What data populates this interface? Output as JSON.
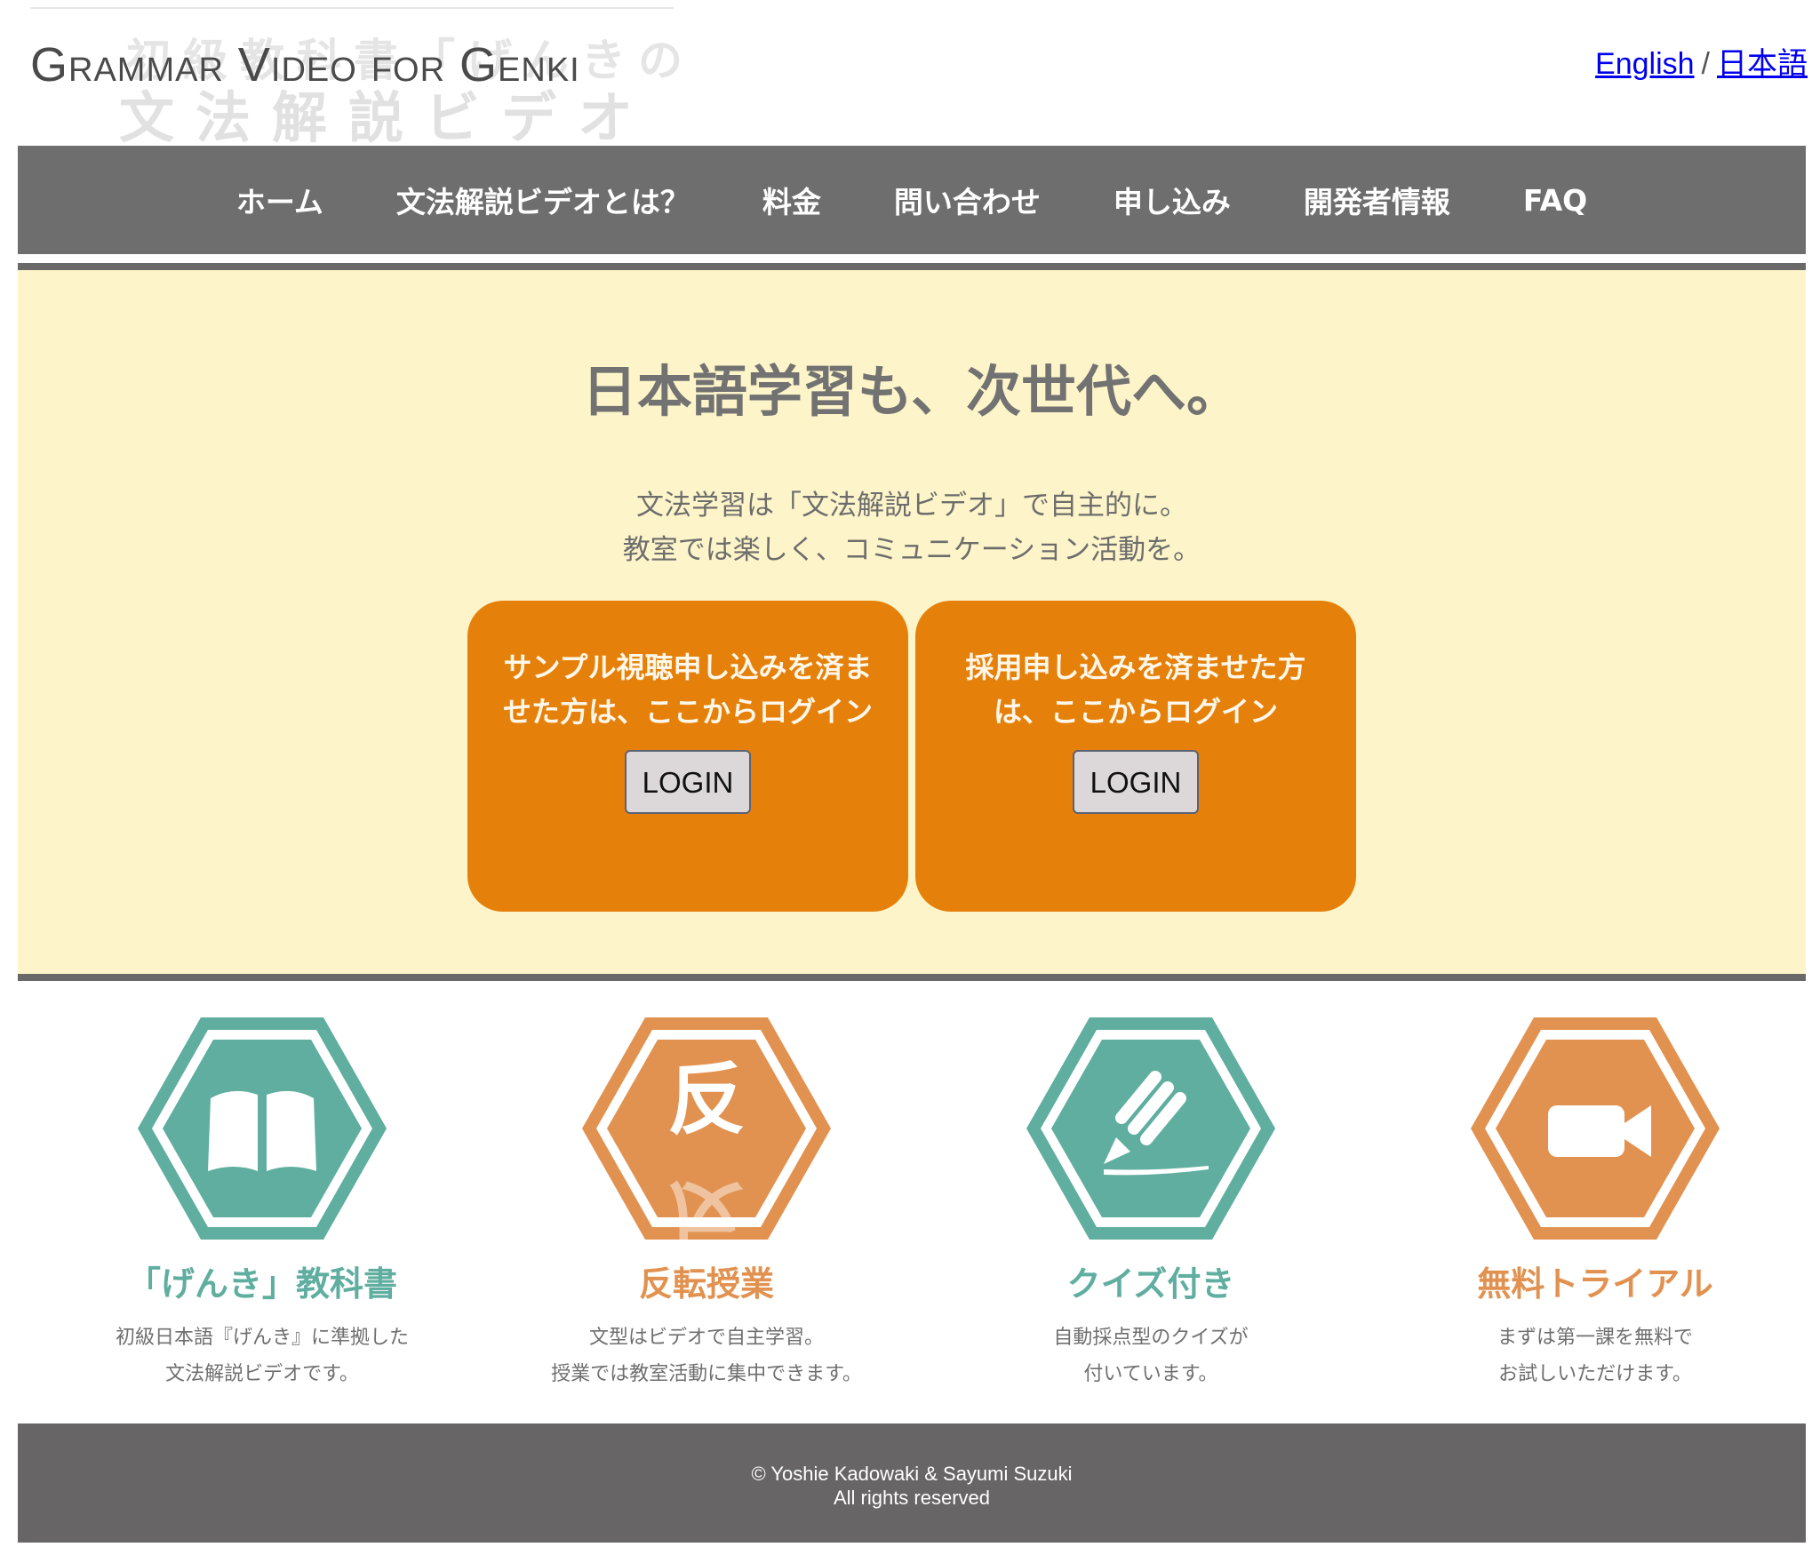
{
  "header": {
    "logo_en": "Grammar Video for Genki",
    "logo_jp_top": "初級教科書「げんきの",
    "logo_jp_bottom": "文法解説ビデオ",
    "lang_english": "English",
    "lang_sep": "/",
    "lang_japanese": "日本語"
  },
  "nav": {
    "items": [
      "ホーム",
      "文法解説ビデオとは？",
      "料金",
      "問い合わせ",
      "申し込み",
      "開発者情報",
      "FAQ"
    ]
  },
  "hero": {
    "title": "日本語学習も、次世代へ。",
    "subtitle_line1": "文法学習は「文法解説ビデオ」で自主的に。",
    "subtitle_line2": "教室では楽しく、コミュニケーション活動を。",
    "cards": [
      {
        "text_line1": "サンプル視聴申し込みを済ま",
        "text_line2": "せた方は、ここからログイン",
        "button": "LOGIN"
      },
      {
        "text_line1": "採用申し込みを済ませた方",
        "text_line2": "は、ここからログイン",
        "button": "LOGIN"
      }
    ]
  },
  "features": [
    {
      "icon": "book-icon",
      "title": "「げんき」教科書",
      "desc_line1": "初級日本語『げんき』に準拠した",
      "desc_line2": "文法解説ビデオです。",
      "color": "#5fae9f"
    },
    {
      "icon": "flip-kanji-icon",
      "glyph": "反",
      "title": "反転授業",
      "desc_line1": "文型はビデオで自主学習。",
      "desc_line2": "授業では教室活動に集中できます。",
      "color": "#e29250"
    },
    {
      "icon": "pencil-icon",
      "title": "クイズ付き",
      "desc_line1": "自動採点型のクイズが",
      "desc_line2": "付いています。",
      "color": "#5fae9f"
    },
    {
      "icon": "video-camera-icon",
      "title": "無料トライアル",
      "desc_line1": "まずは第一課を無料で",
      "desc_line2": "お試しいただけます。",
      "color": "#e29250"
    }
  ],
  "footer": {
    "line1": "© Yoshie Kadowaki & Sayumi Suzuki",
    "line2": "All rights reserved"
  },
  "colors": {
    "nav_bg": "#6f6e6e",
    "hero_bg": "#fdf5c9",
    "card_orange": "#e5810b",
    "teal": "#5fae9f",
    "orange": "#e29250",
    "footer_bg": "#676565"
  }
}
